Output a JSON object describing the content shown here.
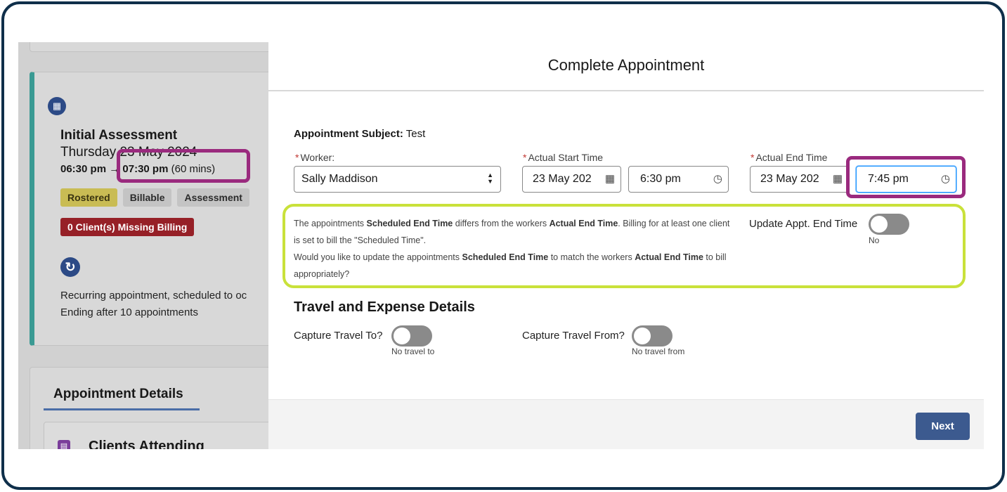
{
  "background": {
    "event_title": "Initial Assessment",
    "event_date": "Thursday 23 May 2024",
    "time_start": "06:30 pm",
    "time_arrow": "→",
    "time_end": "07:30 pm",
    "duration": "(60 mins)",
    "badges": [
      "Rostered",
      "Billable",
      "Assessment"
    ],
    "missing_billing": "0 Client(s) Missing Billing",
    "recurring_text": "Recurring appointment, scheduled to oc",
    "recurring_end": "Ending after 10 appointments",
    "details_tab": "Appointment Details",
    "clients_title": "Clients Attending"
  },
  "modal": {
    "title": "Complete Appointment",
    "subject_label": "Appointment Subject:",
    "subject_value": "Test",
    "worker_label": "Worker:",
    "worker_value": "Sally Maddison",
    "start_label": "Actual Start Time",
    "start_date": "23 May 202",
    "start_time": "6:30 pm",
    "end_label": "Actual End Time",
    "end_date": "23 May 202",
    "end_time": "7:45 pm",
    "note": {
      "p1": "The appointments ",
      "b1": "Scheduled End Time",
      "p2": " differs from the workers ",
      "b2": "Actual End Time",
      "p3": ". Billing for at least one client is set to bill the \"Scheduled Time\".",
      "p4": "Would you like to update the appointments ",
      "b3": "Scheduled End Time",
      "p5": " to match the workers ",
      "b4": "Actual End Time",
      "p6": " to bill appropriately?"
    },
    "update_label": "Update Appt. End Time",
    "update_state": "No",
    "travel_section": "Travel and Expense Details",
    "travel_to_label": "Capture Travel To?",
    "travel_to_state": "No travel to",
    "travel_from_label": "Capture Travel From?",
    "travel_from_state": "No travel from",
    "next_label": "Next"
  },
  "colors": {
    "frame": "#0f2f4a",
    "highlight_purple": "#9a2a7e",
    "highlight_green": "#c9e13a",
    "brand_button": "#3c5a8f",
    "rostered_badge": "#c9bc54",
    "missing_badge": "#962027"
  }
}
